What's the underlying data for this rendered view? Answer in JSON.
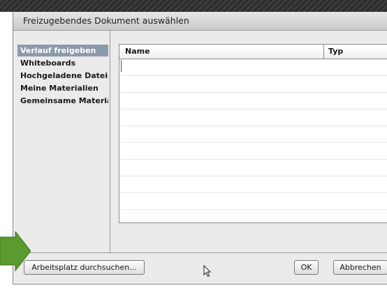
{
  "dialog": {
    "title": "Freizugebendes Dokument auswählen"
  },
  "sidebar": {
    "items": [
      {
        "label": "Verlauf freigeben",
        "selected": true
      },
      {
        "label": "Whiteboards",
        "selected": false
      },
      {
        "label": "Hochgeladene Dateien",
        "selected": false
      },
      {
        "label": "Meine Materialien",
        "selected": false
      },
      {
        "label": "Gemeinsame Materialien",
        "selected": false
      }
    ]
  },
  "table": {
    "columns": [
      "Name",
      "Typ"
    ],
    "rows": []
  },
  "footer": {
    "browse_label": "Arbeitsplatz durchsuchen...",
    "ok_label": "OK",
    "cancel_label": "Abbrechen"
  },
  "icons": {
    "arrow": "green-arrow-icon",
    "cursor": "mouse-pointer-icon"
  },
  "colors": {
    "selection": "#8d9aac",
    "arrow": "#5a9a2e"
  }
}
